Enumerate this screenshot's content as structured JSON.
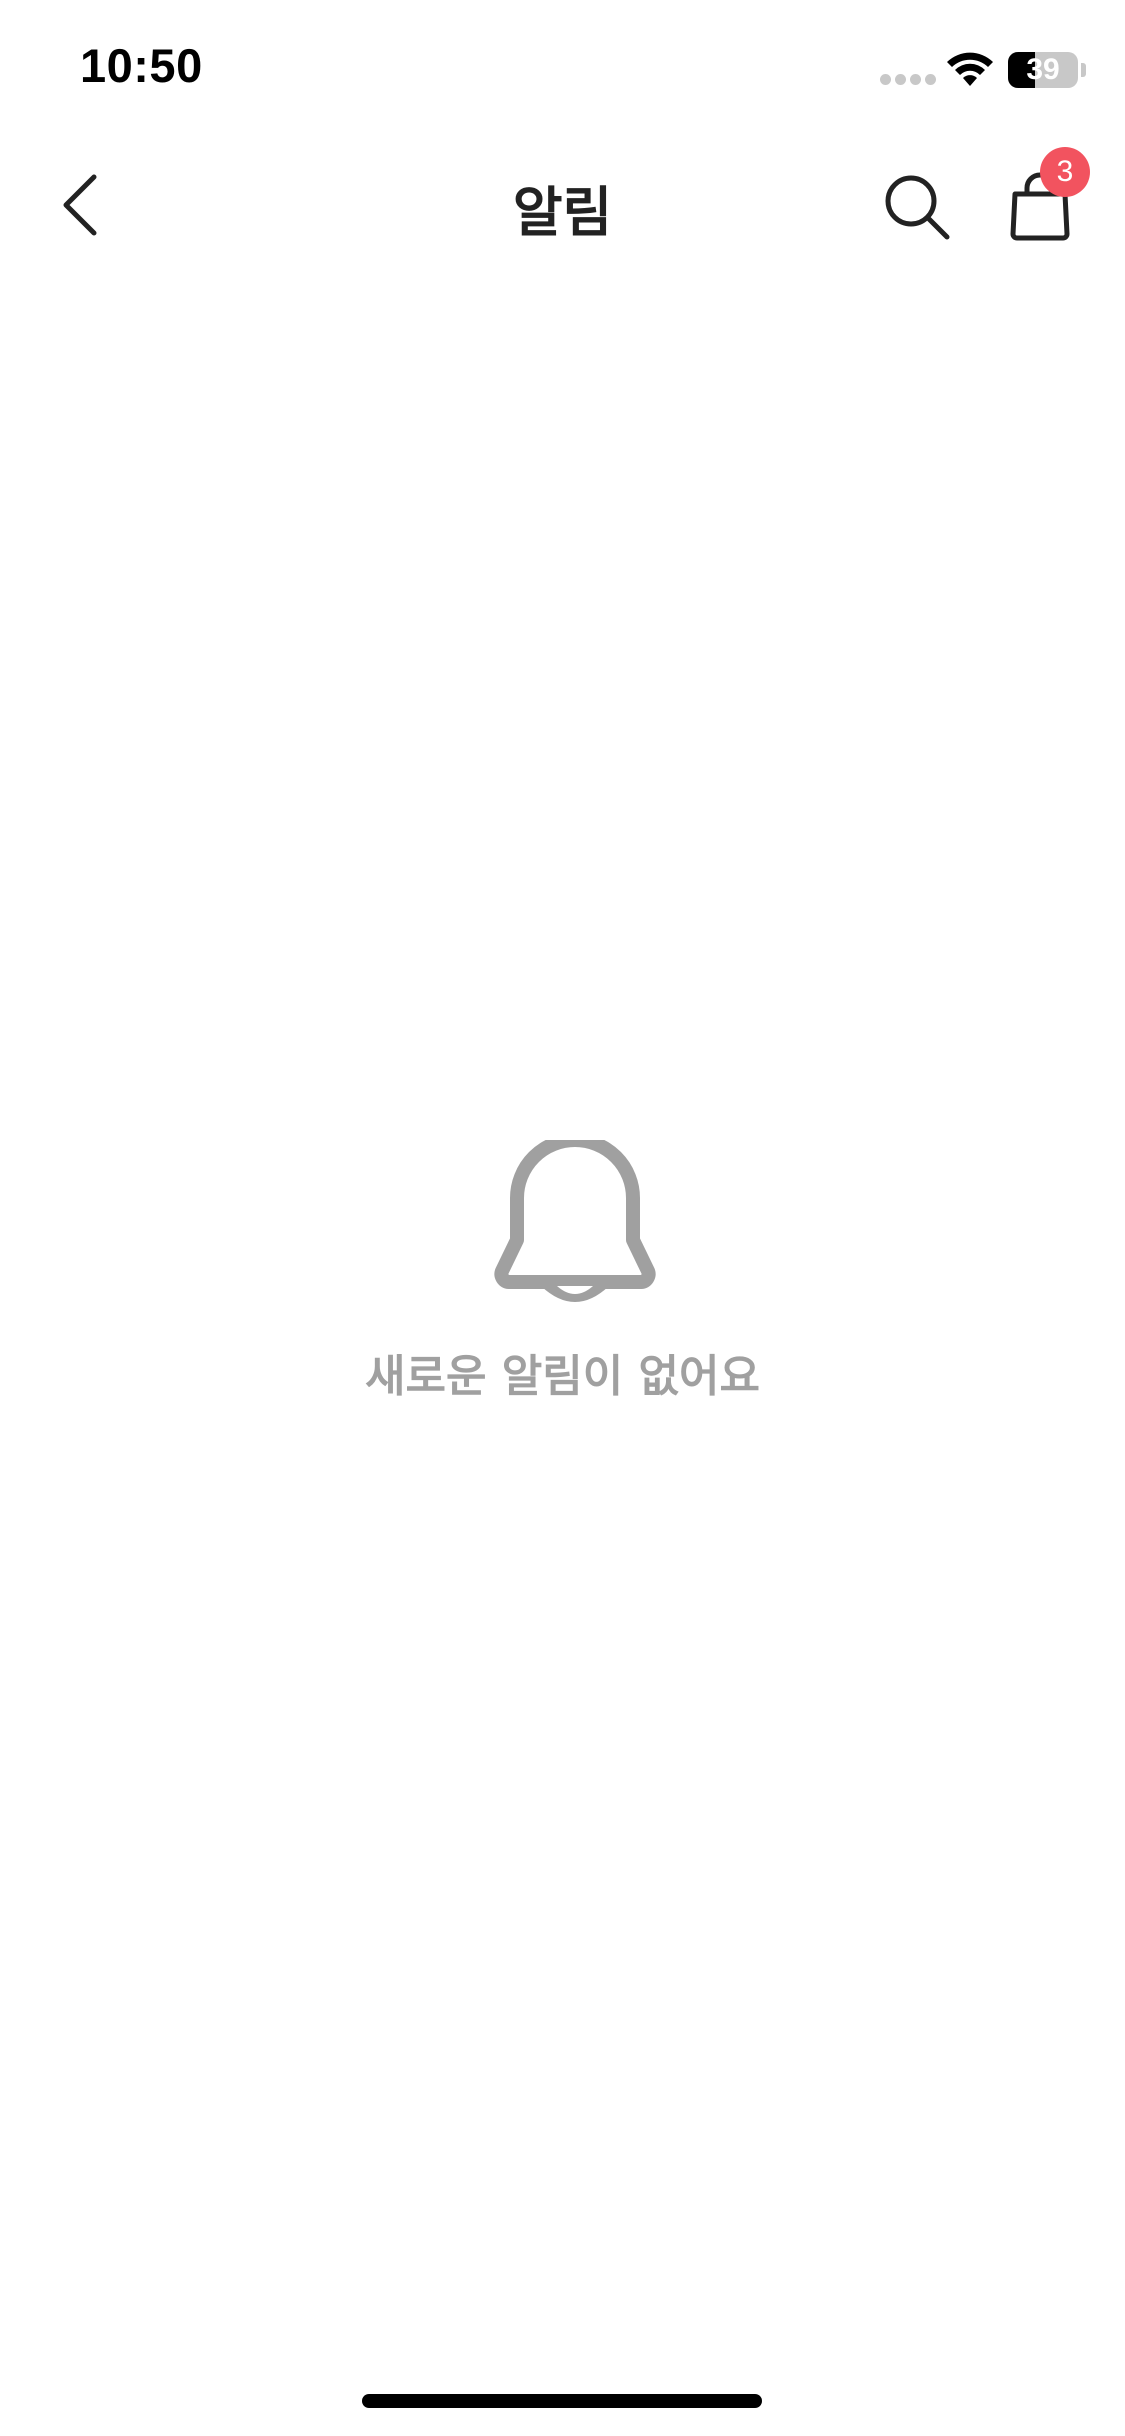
{
  "status_bar": {
    "time": "10:50",
    "battery_level": "39",
    "battery_fraction": 0.39
  },
  "nav": {
    "title": "알림",
    "back_icon": "chevron-left-icon",
    "search_icon": "search-icon",
    "cart_icon": "shopping-bag-icon",
    "cart_badge_count": "3"
  },
  "empty_state": {
    "icon": "bell-icon",
    "message": "새로운 알림이 없어요"
  },
  "colors": {
    "badge": "#f2535f",
    "empty_gray": "#a0a0a0",
    "text_dark": "#222222"
  }
}
